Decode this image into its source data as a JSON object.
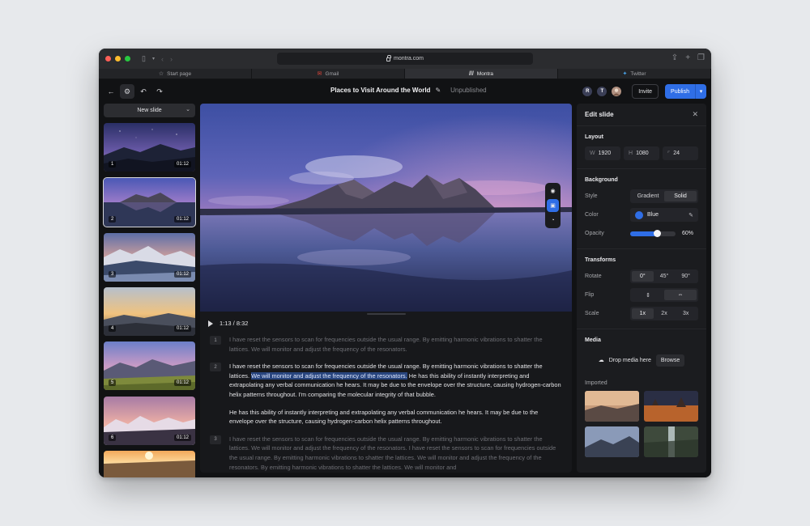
{
  "browser": {
    "url": "montra.com",
    "tabs": [
      {
        "label": "Start page",
        "icon": "star-icon"
      },
      {
        "label": "Gmail",
        "icon": "gmail-icon"
      },
      {
        "label": "Montra",
        "icon": "montra-icon"
      },
      {
        "label": "Twitter",
        "icon": "twitter-icon"
      }
    ]
  },
  "header": {
    "title": "Places to Visit Around the World",
    "status": "Unpublished",
    "avatars": [
      "R",
      "T"
    ],
    "invite": "Invite",
    "publish": "Publish"
  },
  "slides": {
    "new_slide": "New slide",
    "items": [
      {
        "num": "1",
        "duration": "01:12"
      },
      {
        "num": "2",
        "duration": "01:12"
      },
      {
        "num": "3",
        "duration": "01:12"
      },
      {
        "num": "4",
        "duration": "01:12"
      },
      {
        "num": "5",
        "duration": "01:12"
      },
      {
        "num": "6",
        "duration": "01:12"
      }
    ],
    "active_index": 2
  },
  "player": {
    "time": "1:13 / 8:32"
  },
  "transcript": [
    {
      "num": "1",
      "state": "dim",
      "pre": "I have reset the sensors to scan for frequencies outside the usual range. By emitting harmonic vibrations to shatter the lattices. We will monitor and adjust the frequency of the resonators.",
      "highlight": "",
      "post": ""
    },
    {
      "num": "2",
      "state": "bright",
      "pre": "I have reset the sensors to scan for frequencies outside the usual range. By emitting harmonic vibrations to shatter the lattices.",
      "highlight": "We will monitor and adjust the frequency of the resonators.",
      "post": "He has this ability of instantly interpreting and extrapolating any verbal communication he hears. It may be due to the envelope over the structure, causing hydrogen-carbon helix patterns throughout. I'm comparing the molecular integrity of that bubble."
    },
    {
      "num": "",
      "state": "bright",
      "pre": "He has this ability of instantly interpreting and extrapolating any verbal communication he hears. It may be due to the envelope over the structure, causing hydrogen-carbon helix patterns throughout.",
      "highlight": "",
      "post": ""
    },
    {
      "num": "3",
      "state": "dim",
      "pre": "I have reset the sensors to scan for frequencies outside the usual range. By emitting harmonic vibrations to shatter the lattices. We will monitor and adjust the frequency of the resonators. I have reset the sensors to scan for frequencies outside the usual range. By emitting harmonic vibrations to shatter the lattices. We will monitor and adjust the frequency of the resonators. By emitting harmonic vibrations to shatter the lattices. We will monitor and",
      "highlight": "",
      "post": ""
    }
  ],
  "panel": {
    "title": "Edit slide",
    "layout": {
      "title": "Layout",
      "w_label": "W",
      "w": "1920",
      "h_label": "H",
      "h": "1080",
      "r_label": "⌜",
      "r": "24"
    },
    "background": {
      "title": "Background",
      "style_label": "Style",
      "style_options": [
        "Gradient",
        "Solid"
      ],
      "style_selected": "Solid",
      "color_label": "Color",
      "color_name": "Blue",
      "color_hex": "#2f6ee6",
      "opacity_label": "Opacity",
      "opacity_value": "60%",
      "opacity_fraction": 0.6
    },
    "transforms": {
      "title": "Transforms",
      "rotate_label": "Rotate",
      "rotate_options": [
        "0°",
        "45°",
        "90°"
      ],
      "flip_label": "Flip",
      "scale_label": "Scale",
      "scale_options": [
        "1x",
        "2x",
        "3x"
      ]
    },
    "media": {
      "title": "Media",
      "drop": "Drop media here",
      "browse": "Browse",
      "imported": "Imported"
    }
  },
  "colors": {
    "accent": "#2f6ee6",
    "traffic_red": "#ff5f57",
    "traffic_yellow": "#febc2e",
    "traffic_green": "#28c840"
  }
}
